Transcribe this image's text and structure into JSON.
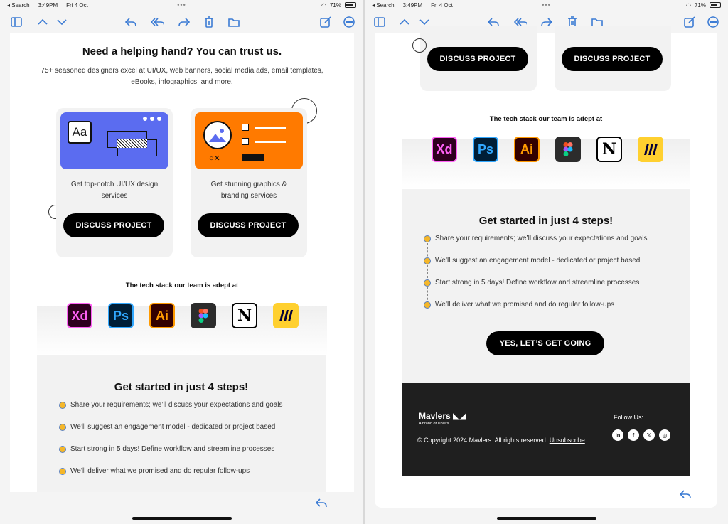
{
  "status": {
    "search": "◂ Search",
    "time": "3:49PM",
    "date": "Fri 4 Oct",
    "battery": "71%"
  },
  "left": {
    "hero_title": "Need a helping hand? You can trust us.",
    "hero_sub": "75+ seasoned designers excel at UI/UX, web banners, social media ads, email templates, eBooks, infographics, and more.",
    "cards": [
      {
        "desc": "Get top-notch UI/UX design services",
        "button": "DISCUSS PROJECT",
        "thumb_label": "Aa"
      },
      {
        "desc": "Get stunning graphics & branding services",
        "button": "DISCUSS PROJECT"
      }
    ]
  },
  "tech": {
    "title": "The tech stack our team is adept at",
    "icons": [
      {
        "name": "xd-icon",
        "label": "Xd",
        "bg": "#2e001f",
        "fg": "#ff61f6",
        "border": "#ff61f6"
      },
      {
        "name": "photoshop-icon",
        "label": "Ps",
        "bg": "#001e36",
        "fg": "#31a8ff",
        "border": "#31a8ff"
      },
      {
        "name": "illustrator-icon",
        "label": "Ai",
        "bg": "#330000",
        "fg": "#ff9a00",
        "border": "#ff9a00"
      },
      {
        "name": "figma-icon",
        "label": "",
        "bg": "#2c2c2c",
        "fg": "#ffffff",
        "border": "#2c2c2c"
      },
      {
        "name": "notion-icon",
        "label": "N",
        "bg": "#ffffff",
        "fg": "#000000",
        "border": "#000000"
      },
      {
        "name": "miro-icon",
        "label": "",
        "bg": "#ffd02f",
        "fg": "#050038",
        "border": "#ffd02f"
      }
    ]
  },
  "steps": {
    "title": "Get started in just 4 steps!",
    "items": [
      "Share your requirements; we’ll discuss your expectations and goals",
      "We’ll suggest an engagement model - dedicated or project based",
      "Start strong in 5 days! Define workflow and streamline processes",
      "We’ll deliver what we promised and do regular follow-ups"
    ],
    "cta": "YES, LET’S GET GOING"
  },
  "right": {
    "buttons": [
      "DISCUSS PROJECT",
      "DISCUSS PROJECT"
    ]
  },
  "footer": {
    "brand": "Mavlers",
    "brand_sub": "A brand of Uplers",
    "copyright": "© Copyright 2024 Mavlers. All rights reserved.",
    "unsubscribe": "Unsubscribe",
    "follow": "Follow Us:",
    "social": [
      "in",
      "f",
      "𝕏",
      "◎"
    ]
  },
  "colors": {
    "accent": "#3b7bd4",
    "card_blue": "#5b6cf0",
    "card_orange": "#ff7a00",
    "step_dot": "#f5b72a"
  }
}
